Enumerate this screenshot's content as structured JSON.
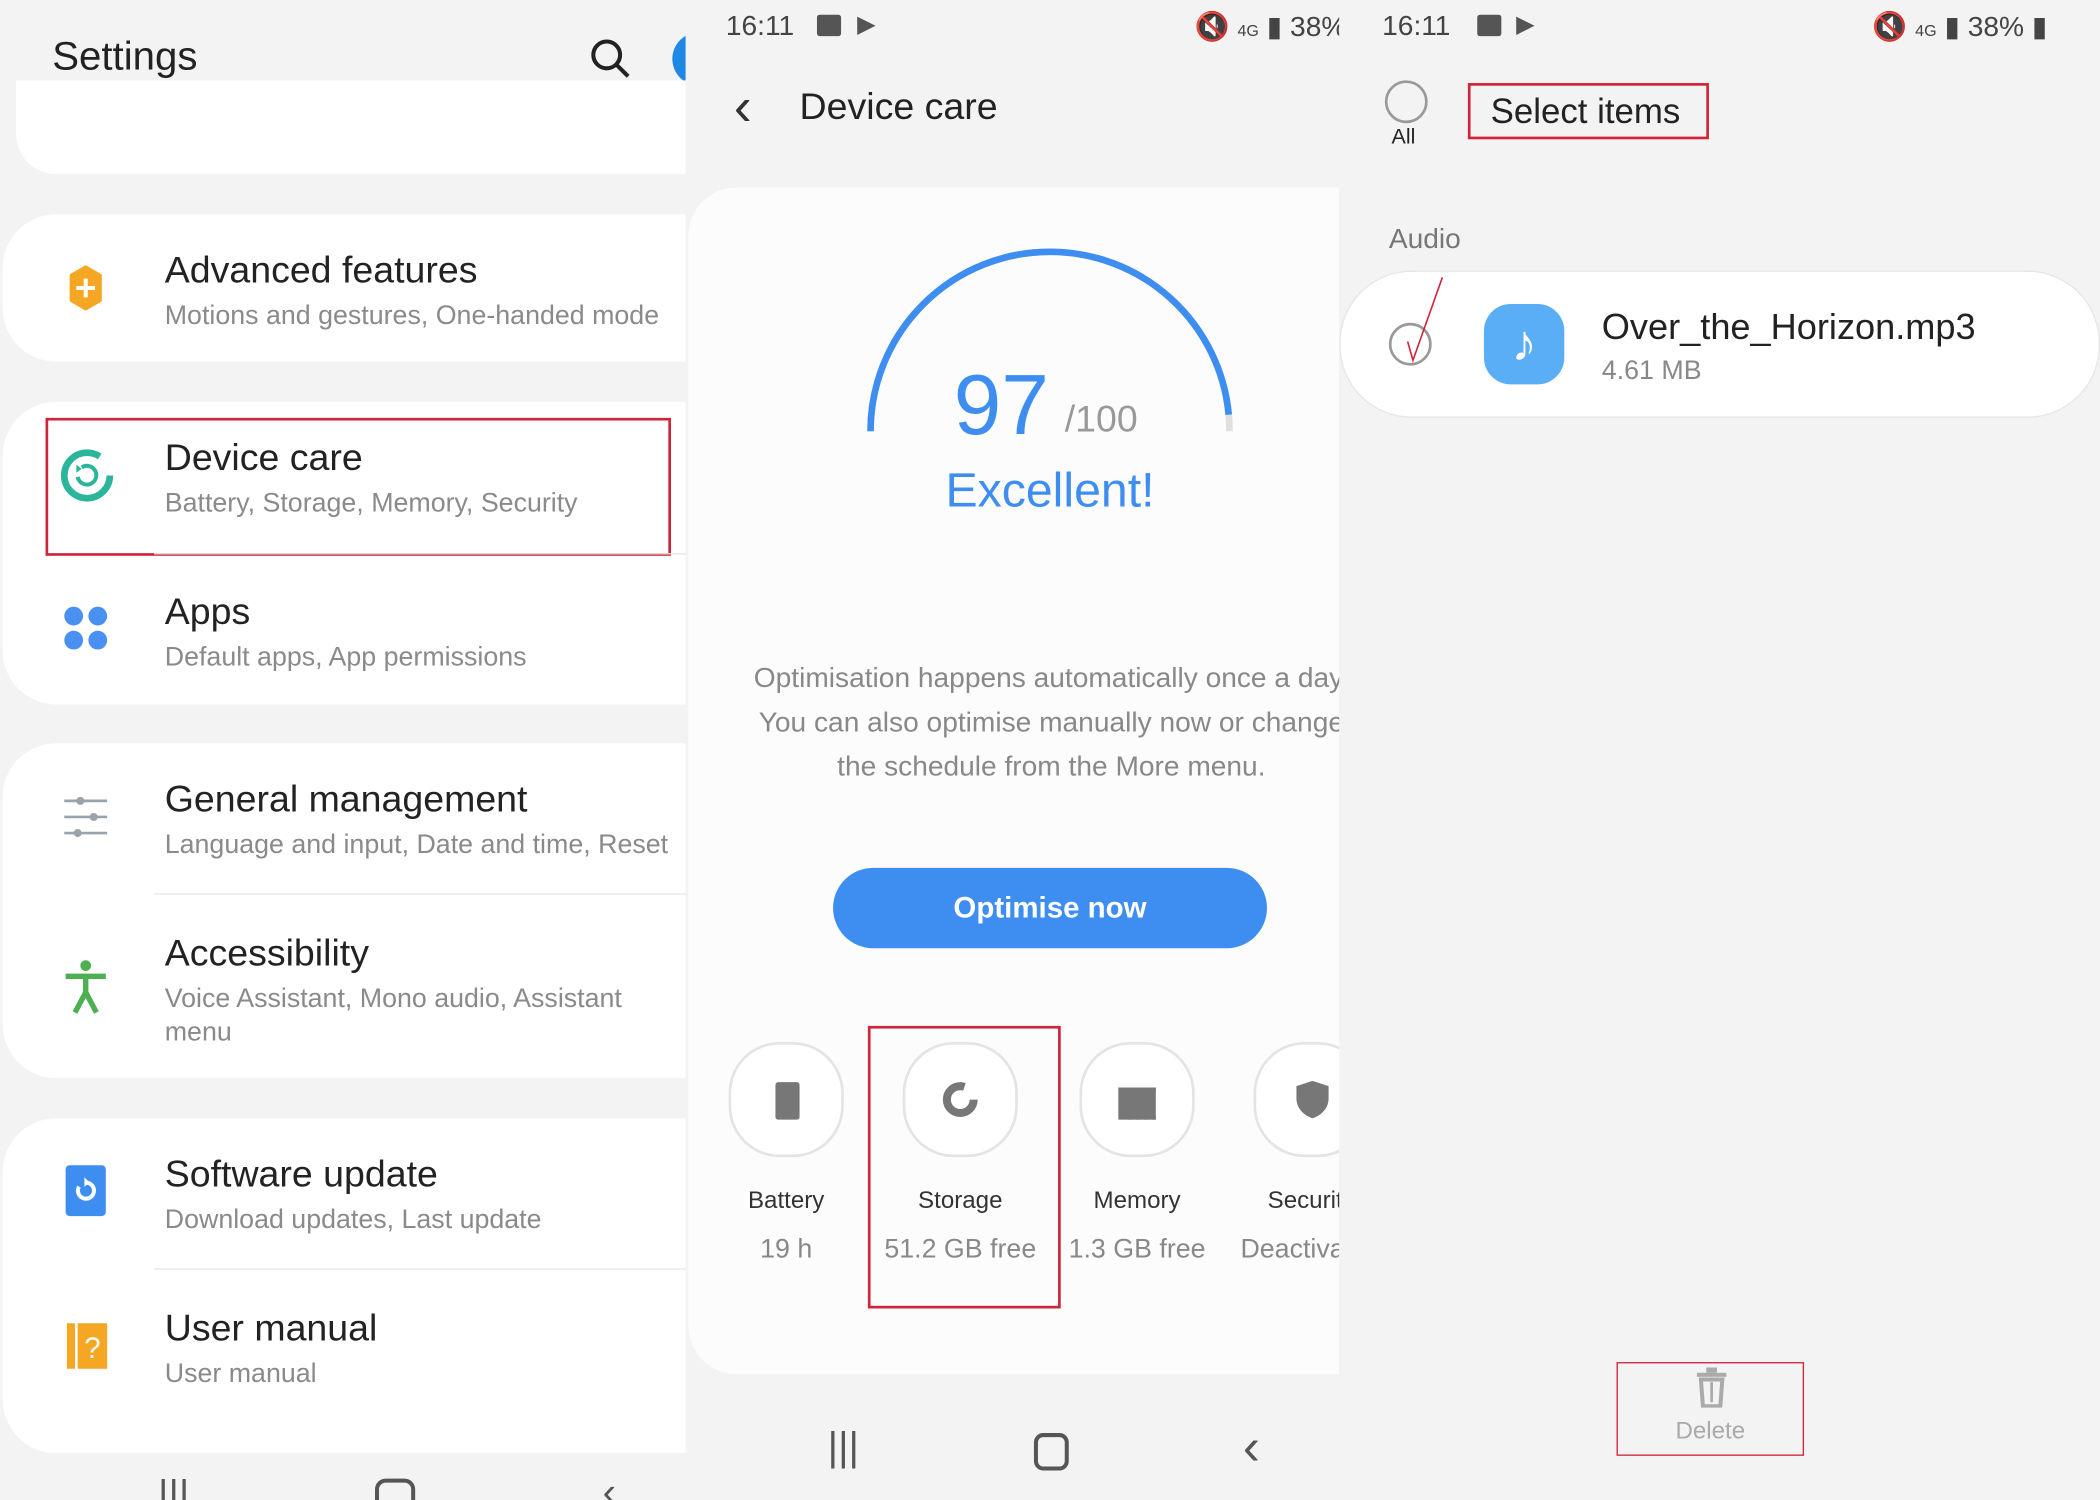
{
  "settings": {
    "title": "Settings",
    "items": [
      {
        "title": "Advanced features",
        "subtitle": "Motions and gestures, One-handed mode",
        "icon": "advanced-features-icon",
        "color": "#f5a623"
      },
      {
        "title": "Device care",
        "subtitle": "Battery, Storage, Memory, Security",
        "icon": "device-care-icon",
        "color": "#2bb59a"
      },
      {
        "title": "Apps",
        "subtitle": "Default apps, App permissions",
        "icon": "apps-icon",
        "color": "#4a90f0"
      },
      {
        "title": "General management",
        "subtitle": "Language and input, Date and time, Reset",
        "icon": "sliders-icon",
        "color": "#9aa3ad"
      },
      {
        "title": "Accessibility",
        "subtitle": "Voice Assistant, Mono audio, Assistant menu",
        "icon": "accessibility-icon",
        "color": "#4caf50"
      },
      {
        "title": "Software update",
        "subtitle": "Download updates, Last update",
        "icon": "software-update-icon",
        "color": "#3d8ef0"
      },
      {
        "title": "User manual",
        "subtitle": "User manual",
        "icon": "user-manual-icon",
        "color": "#f5a623"
      }
    ]
  },
  "device_care": {
    "status_time": "16:11",
    "status_battery": "38%",
    "title": "Device care",
    "score": "97",
    "score_max": "/100",
    "score_percent": 97,
    "rating": "Excellent!",
    "description": "Optimisation happens automatically once a day. You can also optimise manually now or change the schedule from the More menu.",
    "optimise_button": "Optimise now",
    "tiles": [
      {
        "label": "Battery",
        "value": "19 h",
        "icon": "battery-icon"
      },
      {
        "label": "Storage",
        "value": "51.2 GB free",
        "icon": "storage-icon"
      },
      {
        "label": "Memory",
        "value": "1.3 GB free",
        "icon": "memory-icon"
      },
      {
        "label": "Security",
        "value": "Deactivated",
        "icon": "shield-icon"
      }
    ],
    "accent": "#3d8ef0"
  },
  "select": {
    "status_time": "16:11",
    "status_battery": "38%",
    "all_label": "All",
    "title": "Select items",
    "section": "Audio",
    "file_name": "Over_the_Horizon.mp3",
    "file_size": "4.61 MB",
    "delete_label": "Delete"
  }
}
